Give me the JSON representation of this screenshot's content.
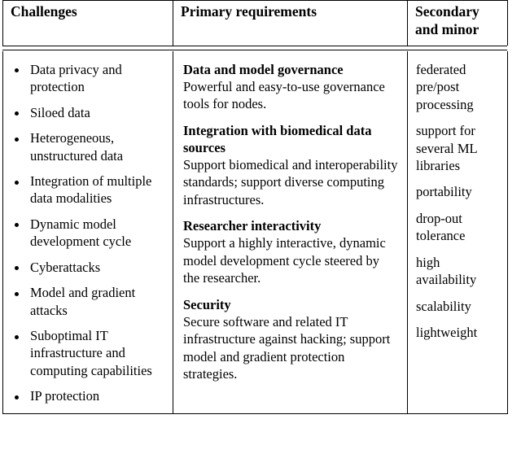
{
  "table": {
    "headers": {
      "challenges": "Challenges",
      "primary": "Primary requirements",
      "secondary": "Secondary and minor"
    },
    "challenges": [
      "Data privacy and protection",
      "Siloed data",
      "Heterogeneous, unstructured data",
      "Integration of multiple data modalities",
      "Dynamic model development cycle",
      "Cyberattacks",
      "Model and gradient attacks",
      "Suboptimal IT infrastructure and computing capabilities",
      "IP protection"
    ],
    "primary_requirements": [
      {
        "title": "Data and model governance",
        "description": "Powerful and easy-to-use governance tools for nodes."
      },
      {
        "title": "Integration with biomedical data sources",
        "description": "Support biomedical and interoperability standards; support diverse computing infrastructures."
      },
      {
        "title": "Researcher interactivity",
        "description": "Support a highly interactive, dynamic model development cycle steered by the researcher."
      },
      {
        "title": "Security",
        "description": "Secure software and related IT infrastructure against hacking; support model and gradient protection strategies."
      }
    ],
    "secondary_and_minor": [
      "federated pre/post processing",
      "support for several ML libraries",
      "portability",
      "drop-out tolerance",
      "high availability",
      "scalability",
      "lightweight"
    ]
  }
}
